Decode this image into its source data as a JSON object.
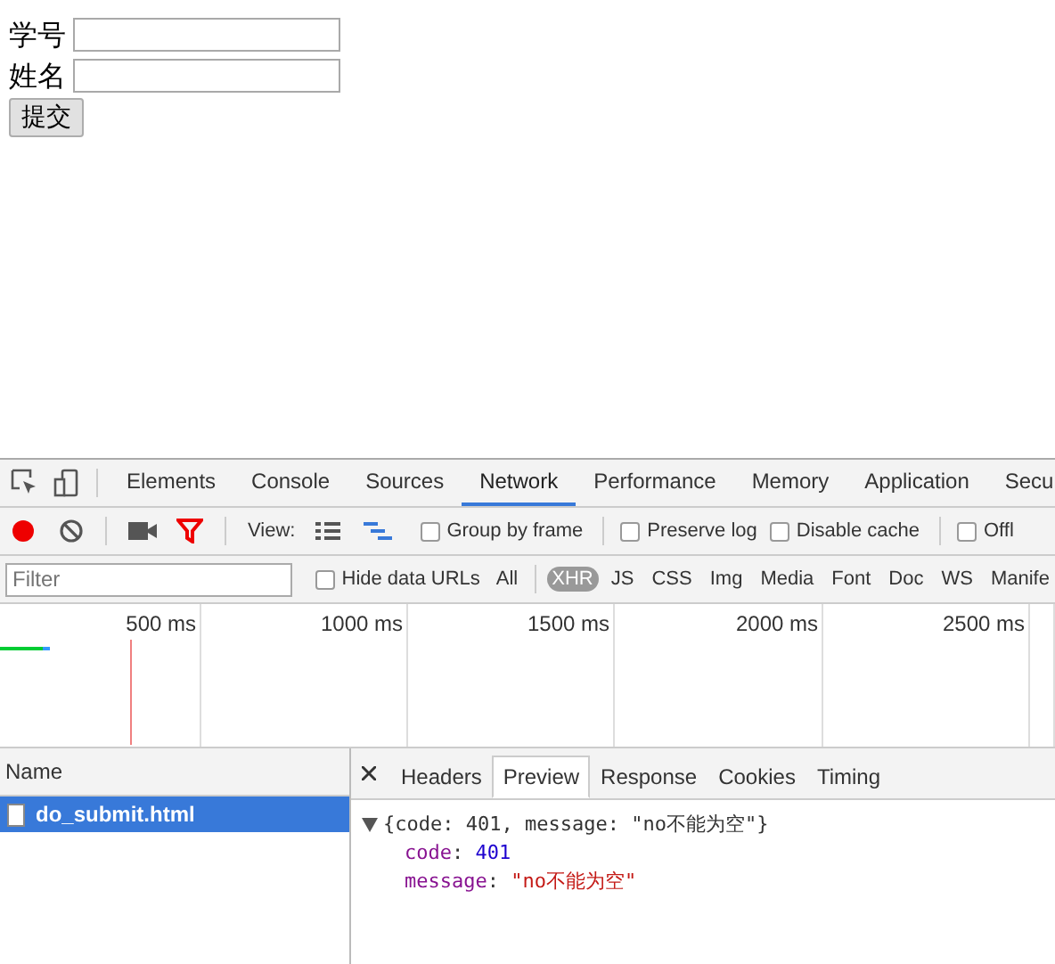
{
  "form": {
    "fields": [
      {
        "label": "学号"
      },
      {
        "label": "姓名"
      }
    ],
    "submit_button": "提交"
  },
  "devtools": {
    "tabs": [
      {
        "label": "Elements",
        "selected": false
      },
      {
        "label": "Console",
        "selected": false
      },
      {
        "label": "Sources",
        "selected": false
      },
      {
        "label": "Network",
        "selected": true
      },
      {
        "label": "Performance",
        "selected": false
      },
      {
        "label": "Memory",
        "selected": false
      },
      {
        "label": "Application",
        "selected": false
      },
      {
        "label": "Secu",
        "selected": false
      }
    ],
    "toolbar": {
      "recording": true,
      "view_label": "View:",
      "checkboxes": [
        {
          "label": "Group by frame",
          "checked": false
        },
        {
          "label": "Preserve log",
          "checked": false
        },
        {
          "label": "Disable cache",
          "checked": false
        },
        {
          "label": "Offl",
          "checked": false
        }
      ]
    },
    "filter": {
      "placeholder": "Filter",
      "hide_data_urls": {
        "label": "Hide data URLs",
        "checked": false
      },
      "types": [
        {
          "label": "All",
          "selected": false
        },
        {
          "label": "XHR",
          "selected": true
        },
        {
          "label": "JS",
          "selected": false
        },
        {
          "label": "CSS",
          "selected": false
        },
        {
          "label": "Img",
          "selected": false
        },
        {
          "label": "Media",
          "selected": false
        },
        {
          "label": "Font",
          "selected": false
        },
        {
          "label": "Doc",
          "selected": false
        },
        {
          "label": "WS",
          "selected": false
        },
        {
          "label": "Manife",
          "selected": false
        }
      ]
    },
    "timeline": {
      "ticks": [
        "500 ms",
        "1000 ms",
        "1500 ms",
        "2000 ms",
        "2500 ms"
      ]
    },
    "requests": {
      "header": "Name",
      "items": [
        {
          "name": "do_submit.html",
          "selected": true
        }
      ]
    },
    "detail": {
      "tabs": [
        {
          "label": "Headers",
          "selected": false
        },
        {
          "label": "Preview",
          "selected": true
        },
        {
          "label": "Response",
          "selected": false
        },
        {
          "label": "Cookies",
          "selected": false
        },
        {
          "label": "Timing",
          "selected": false
        }
      ],
      "preview": {
        "summary": "{code: 401, message: \"no不能为空\"}",
        "expanded": true,
        "separator": ": ",
        "props": [
          {
            "key": "code",
            "value": "401",
            "kind": "number"
          },
          {
            "key": "message",
            "value": "\"no不能为空\"",
            "kind": "string"
          }
        ]
      }
    }
  }
}
